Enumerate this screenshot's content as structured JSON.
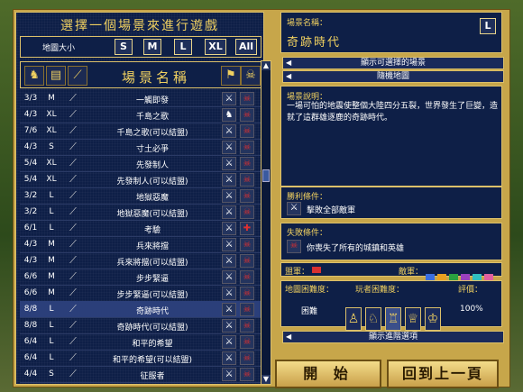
{
  "left": {
    "title": "選擇一個場景來進行遊戲",
    "size_label": "地圖大小",
    "size_buttons": [
      "S",
      "M",
      "L",
      "XL",
      "All"
    ],
    "header": {
      "name_label": "場景名稱"
    },
    "rows": [
      {
        "players": "3/3",
        "size": "M",
        "name": "一觸即發",
        "win": "general",
        "lose": "skull"
      },
      {
        "players": "4/3",
        "size": "XL",
        "name": "千島之歌",
        "win": "knight",
        "lose": "skull"
      },
      {
        "players": "7/6",
        "size": "XL",
        "name": "千島之歌(可以結盟)",
        "win": "general",
        "lose": "skull"
      },
      {
        "players": "4/3",
        "size": "S",
        "name": "寸土必爭",
        "win": "general",
        "lose": "skull"
      },
      {
        "players": "5/4",
        "size": "XL",
        "name": "先發制人",
        "win": "general",
        "lose": "skull"
      },
      {
        "players": "5/4",
        "size": "XL",
        "name": "先發制人(可以結盟)",
        "win": "general",
        "lose": "skull"
      },
      {
        "players": "3/2",
        "size": "L",
        "name": "地獄惡魔",
        "win": "general",
        "lose": "skull"
      },
      {
        "players": "3/2",
        "size": "L",
        "name": "地獄惡魔(可以結盟)",
        "win": "general",
        "lose": "skull"
      },
      {
        "players": "6/1",
        "size": "L",
        "name": "考驗",
        "win": "general",
        "lose": "special"
      },
      {
        "players": "4/3",
        "size": "M",
        "name": "兵來將擋",
        "win": "general",
        "lose": "skull"
      },
      {
        "players": "4/3",
        "size": "M",
        "name": "兵來將擋(可以結盟)",
        "win": "general",
        "lose": "skull"
      },
      {
        "players": "6/6",
        "size": "M",
        "name": "步步緊逼",
        "win": "general",
        "lose": "skull"
      },
      {
        "players": "6/6",
        "size": "M",
        "name": "步步緊逼(可以結盟)",
        "win": "general",
        "lose": "skull"
      },
      {
        "players": "8/8",
        "size": "L",
        "name": "奇跡時代",
        "win": "general",
        "lose": "skull",
        "selected": true
      },
      {
        "players": "8/8",
        "size": "L",
        "name": "奇跡時代(可以結盟)",
        "win": "general",
        "lose": "skull"
      },
      {
        "players": "6/4",
        "size": "L",
        "name": "和平的希望",
        "win": "general",
        "lose": "skull"
      },
      {
        "players": "6/4",
        "size": "L",
        "name": "和平的希望(可以結盟)",
        "win": "general",
        "lose": "skull"
      },
      {
        "players": "4/4",
        "size": "S",
        "name": "征服者",
        "win": "general",
        "lose": "skull"
      }
    ]
  },
  "right": {
    "scenario_name_label": "場景名稱：",
    "scenario_name": "奇跡時代",
    "map_size_badge": "L",
    "dropdown_options": "顯示可選擇的場景",
    "dropdown_random": "隨機地圖",
    "desc_label": "場景說明：",
    "desc_text": "一場可怕的地震使整個大陸四分五裂，世界發生了巨變，造就了這群雄逐鹿的奇跡時代。",
    "win_label": "勝利條件：",
    "win_text": "擊敗全部敵軍",
    "lose_label": "失敗條件：",
    "lose_text": "你喪失了所有的城鎮和英雄",
    "ally_label": "盟軍：",
    "enemy_label": "敵軍：",
    "difficulty_label": "地圖困難度：",
    "player_difficulty_label": "玩者困難度：",
    "rating_label": "評價：",
    "difficulty_value": "困難",
    "rating_value": "100%",
    "advanced_options": "顯示進階選項",
    "start_button": "開 始",
    "back_button": "回到上一頁"
  },
  "colors": {
    "ally": "#d83030",
    "enemies": [
      "#3a6ee0",
      "#e8a020",
      "#2aa040",
      "#9a40c0",
      "#30c0c0",
      "#e060a0",
      "#888888"
    ]
  }
}
